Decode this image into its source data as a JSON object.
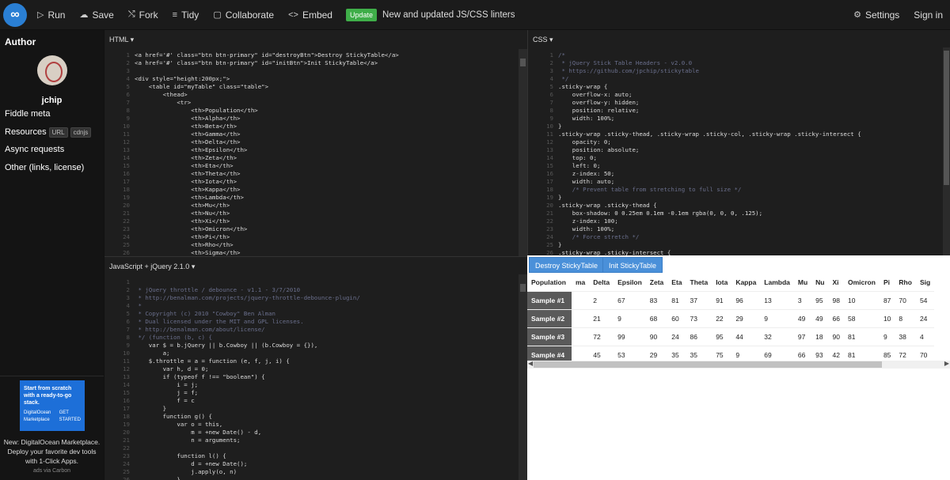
{
  "toolbar": {
    "run": "Run",
    "save": "Save",
    "fork": "Fork",
    "tidy": "Tidy",
    "collaborate": "Collaborate",
    "embed": "Embed",
    "badge": "Update",
    "update_text": "New and updated JS/CSS linters",
    "settings": "Settings",
    "signin": "Sign in",
    "icons": [
      "logo-icon",
      "play-icon",
      "cloud-icon",
      "fork-icon",
      "tidy-icon",
      "chat-icon",
      "embed-icon",
      "settings-icon"
    ]
  },
  "sidebar": {
    "author_heading": "Author",
    "username": "jchip",
    "items": [
      "Fiddle meta",
      "Resources",
      "Async requests",
      "Other (links, license)"
    ],
    "resource_pills": [
      "URL",
      "cdnjs"
    ],
    "ad": {
      "image_text": "Start from scratch with a ready-to-go stack.",
      "brand": "DigitalOcean Marketplace",
      "cta": "GET STARTED",
      "text": "New: DigitalOcean Marketplace. Deploy your favorite dev tools with 1-Click Apps.",
      "by": "ads via Carbon"
    }
  },
  "html_panel": {
    "title": "HTML",
    "lines": [
      "<a href='#' class=\"btn btn-primary\" id=\"destroyBtn\">Destroy StickyTable</a>",
      "<a href='#' class=\"btn btn-primary\" id=\"initBtn\">Init StickyTable</a>",
      "",
      "<div style=\"height:200px;\">",
      "    <table id=\"myTable\" class=\"table\">",
      "        <thead>",
      "            <tr>",
      "                <th>Population</th>",
      "                <th>Alpha</th>",
      "                <th>Beta</th>",
      "                <th>Gamma</th>",
      "                <th>Delta</th>",
      "                <th>Epsilon</th>",
      "                <th>Zeta</th>",
      "                <th>Eta</th>",
      "                <th>Theta</th>",
      "                <th>Iota</th>",
      "                <th>Kappa</th>",
      "                <th>Lambda</th>",
      "                <th>Mu</th>",
      "                <th>Nu</th>",
      "                <th>Xi</th>",
      "                <th>Omicron</th>",
      "                <th>Pi</th>",
      "                <th>Rho</th>",
      "                <th>Sigma</th>"
    ]
  },
  "css_panel": {
    "title": "CSS",
    "lines": [
      "/*",
      " * jQuery Stick Table Headers - v2.0.0",
      " * https://github.com/jpchip/stickytable",
      " */",
      ".sticky-wrap {",
      "    overflow-x: auto;",
      "    overflow-y: hidden;",
      "    position: relative;",
      "    width: 100%;",
      "}",
      ".sticky-wrap .sticky-thead, .sticky-wrap .sticky-col, .sticky-wrap .sticky-intersect {",
      "    opacity: 0;",
      "    position: absolute;",
      "    top: 0;",
      "    left: 0;",
      "    z-index: 50;",
      "    width: auto;",
      "    /* Prevent table from stretching to full size */",
      "}",
      ".sticky-wrap .sticky-thead {",
      "    box-shadow: 0 0.25em 0.1em -0.1em rgba(0, 0, 0, .125);",
      "    z-index: 100;",
      "    width: 100%;",
      "    /* Force stretch */",
      "}",
      ".sticky-wrap .sticky-intersect {"
    ]
  },
  "js_panel": {
    "title": "JavaScript + jQuery 2.1.0",
    "lines": [
      "",
      " * jQuery throttle / debounce - v1.1 - 3/7/2010",
      " * http://benalman.com/projects/jquery-throttle-debounce-plugin/",
      " *",
      " * Copyright (c) 2010 \"Cowboy\" Ben Alman",
      " * Dual licensed under the MIT and GPL licenses.",
      " * http://benalman.com/about/license/",
      " */ (function (b, c) {",
      "    var $ = b.jQuery || b.Cowboy || (b.Cowboy = {}),",
      "        a;",
      "    $.throttle = a = function (e, f, j, i) {",
      "        var h, d = 0;",
      "        if (typeof f !== \"boolean\") {",
      "            i = j;",
      "            j = f;",
      "            f = c",
      "        }",
      "        function g() {",
      "            var o = this,",
      "                m = +new Date() - d,",
      "                n = arguments;",
      "",
      "            function l() {",
      "                d = +new Date();",
      "                j.apply(o, n)",
      "            }"
    ]
  },
  "result": {
    "destroy_label": "Destroy StickyTable",
    "init_label": "Init StickyTable",
    "headers": [
      "Population",
      "ma",
      "Delta",
      "Epsilon",
      "Zeta",
      "Eta",
      "Theta",
      "Iota",
      "Kappa",
      "Lambda",
      "Mu",
      "Nu",
      "Xi",
      "Omicron",
      "Pi",
      "Rho",
      "Sig"
    ],
    "rows": [
      {
        "label": "Sample #1",
        "values": [
          "2",
          "67",
          "83",
          "81",
          "37",
          "91",
          "96",
          "13",
          "3",
          "95",
          "98",
          "10",
          "87",
          "70",
          "54"
        ]
      },
      {
        "label": "Sample #2",
        "values": [
          "21",
          "9",
          "68",
          "60",
          "73",
          "22",
          "29",
          "9",
          "49",
          "49",
          "66",
          "58",
          "10",
          "8",
          "24"
        ]
      },
      {
        "label": "Sample #3",
        "values": [
          "72",
          "99",
          "90",
          "24",
          "86",
          "95",
          "44",
          "32",
          "97",
          "18",
          "90",
          "81",
          "9",
          "38",
          "4"
        ]
      },
      {
        "label": "Sample #4",
        "values": [
          "45",
          "53",
          "29",
          "35",
          "35",
          "75",
          "9",
          "69",
          "66",
          "93",
          "42",
          "81",
          "85",
          "72",
          "70"
        ]
      }
    ]
  },
  "colors": {
    "accent": "#4a90d9",
    "badge": "#3fae49",
    "code_keyword": "#c9a84f",
    "code_string": "#cf5a5a",
    "code_comment": "#6a6f8c",
    "code_number": "#e3742a"
  }
}
